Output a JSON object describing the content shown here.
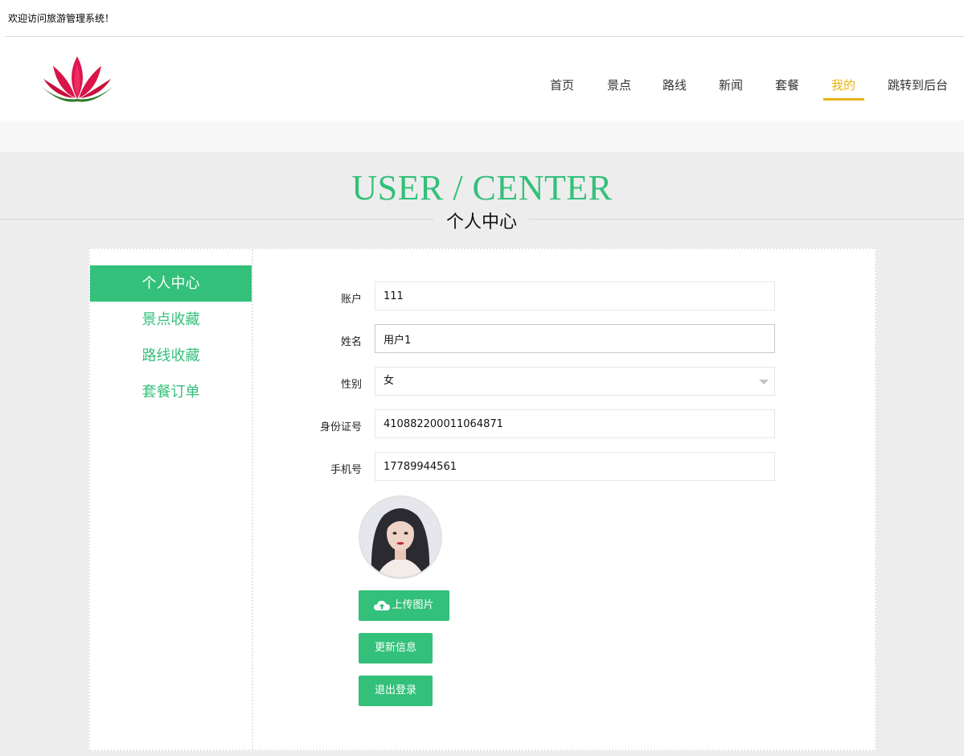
{
  "topbar": {
    "welcome": "欢迎访问旅游管理系统！"
  },
  "nav": {
    "items": [
      "首页",
      "景点",
      "路线",
      "新闻",
      "套餐",
      "我的",
      "跳转到后台"
    ],
    "active_index": 5
  },
  "title": {
    "en": "USER / CENTER",
    "cn": "个人中心"
  },
  "sidebar": {
    "items": [
      "个人中心",
      "景点收藏",
      "路线收藏",
      "套餐订单"
    ],
    "active_index": 0
  },
  "form": {
    "account_label": "账户",
    "account_value": "111",
    "name_label": "姓名",
    "name_value": "用户1",
    "gender_label": "性别",
    "gender_value": "女",
    "idcard_label": "身份证号",
    "idcard_value": "410882200011064871",
    "phone_label": "手机号",
    "phone_value": "17789944561"
  },
  "buttons": {
    "upload": "上传图片",
    "update": "更新信息",
    "logout": "退出登录"
  },
  "colors": {
    "accent": "#33c07a",
    "nav_active": "#e8b414"
  },
  "icons": {
    "logo": "lotus-logo-icon",
    "upload": "cloud-upload-icon",
    "select": "chevron-down-icon"
  }
}
